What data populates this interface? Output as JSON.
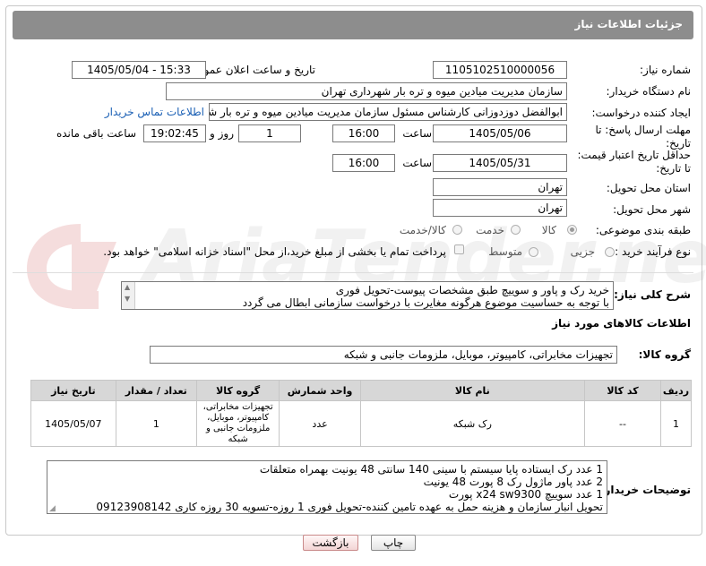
{
  "header": {
    "title": "جزئیات اطلاعات نیاز"
  },
  "watermark": {
    "text": "AriaTender.net"
  },
  "form": {
    "need_number_label": "شماره نیاز:",
    "need_number": "1105102510000056",
    "announce_label": "تاریخ و ساعت اعلان عمومی:",
    "announce_value": "1405/05/04 - 15:33",
    "buyer_org_label": "نام دستگاه خریدار:",
    "buyer_org": "سازمان مدیریت میادین میوه و تره بار شهرداری تهران",
    "creator_label": "ایجاد کننده درخواست:",
    "creator": "ابوالفضل دوزدوزانی کارشناس مسئول سازمان مدیریت میادین میوه و تره بار شهر",
    "contact_link": "اطلاعات تماس خریدار",
    "deadline_label": "مهلت ارسال پاسخ: تا تاریخ:",
    "deadline_date": "1405/05/06",
    "time_label": "ساعت",
    "deadline_time": "16:00",
    "days_value": "1",
    "days_label": "روز و",
    "remaining_time": "19:02:45",
    "remaining_label": "ساعت باقی مانده",
    "validity_label": "حداقل تاریخ اعتبار قیمت: تا تاریخ:",
    "validity_date": "1405/05/31",
    "validity_time_label": "ساعت",
    "validity_time": "16:00",
    "province_label": "استان محل تحویل:",
    "province": "تهران",
    "city_label": "شهر محل تحویل:",
    "city": "تهران",
    "category_label": "طبقه بندی موضوعی:",
    "category_options": [
      "کالا",
      "خدمت",
      "کالا/خدمت"
    ],
    "process_label": "نوع فرآیند خرید :",
    "process_options": [
      "جزیی",
      "متوسط"
    ],
    "payment_note": "پرداخت تمام یا بخشی از مبلغ خرید،از محل \"اسناد خزانه اسلامی\" خواهد بود."
  },
  "summary": {
    "label": "شرح کلی نیاز:",
    "line1": "خرید رک و پاور و سوییچ طبق مشخصات پیوست-تحویل فوری",
    "line2": "با توجه به حساسیت موضوع هرگونه مغایرت با درخواست سازمانی ابطال می گردد"
  },
  "goods_section": {
    "title": "اطلاعات کالاهای مورد نیاز",
    "group_label": "گروه کالا:",
    "group_value": "تجهیزات مخابراتی، کامپیوتر، موبایل، ملزومات جانبی و شبکه"
  },
  "table": {
    "headers": [
      "ردیف",
      "کد کالا",
      "نام کالا",
      "واحد شمارش",
      "گروه کالا",
      "تعداد / مقدار",
      "تاریخ نیاز"
    ],
    "rows": [
      [
        "1",
        "--",
        "رک شبکه",
        "عدد",
        "تجهیزات مخابراتی، کامپیوتر، موبایل، ملزومات جانبی و شبکه",
        "1",
        "1405/05/07"
      ]
    ]
  },
  "buyer_notes": {
    "label": "توضیحات خریدار:",
    "line1": "1 عدد رک ایستاده پایا سیستم با سینی 140 سانتی 48 یونیت بهمراه متعلقات",
    "line2": "2 عدد پاور ماژول رک 8 پورت 48 یونیت",
    "line3": "1 عدد سوییچ x24 sw9300 پورت",
    "line4": "تحویل انبار سازمان و هزینه حمل به عهده تامین کننده-تحویل فوری 1 روزه-تسویه 30 روزه کاری 09123908142"
  },
  "buttons": {
    "print": "چاپ",
    "back": "بازگشت"
  }
}
